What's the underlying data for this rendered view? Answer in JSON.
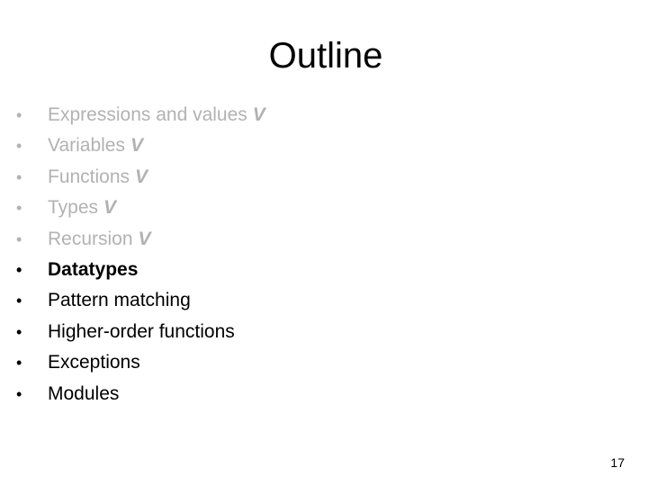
{
  "slide": {
    "title": "Outline",
    "page_number": "17",
    "colors": {
      "completed_text": "#b2b2b2",
      "active_text": "#000000"
    },
    "items": [
      {
        "label": "Expressions and values",
        "mark": "V",
        "state": "done"
      },
      {
        "label": "Variables",
        "mark": "V",
        "state": "done"
      },
      {
        "label": "Functions",
        "mark": "V",
        "state": "done"
      },
      {
        "label": "Types",
        "mark": "V",
        "state": "done"
      },
      {
        "label": "Recursion",
        "mark": "V",
        "state": "done"
      },
      {
        "label": "Datatypes",
        "mark": "",
        "state": "current"
      },
      {
        "label": "Pattern matching",
        "mark": "",
        "state": "pending"
      },
      {
        "label": "Higher-order functions",
        "mark": "",
        "state": "pending"
      },
      {
        "label": "Exceptions",
        "mark": "",
        "state": "pending"
      },
      {
        "label": "Modules",
        "mark": "",
        "state": "pending"
      }
    ],
    "bullet_glyph": "•"
  }
}
